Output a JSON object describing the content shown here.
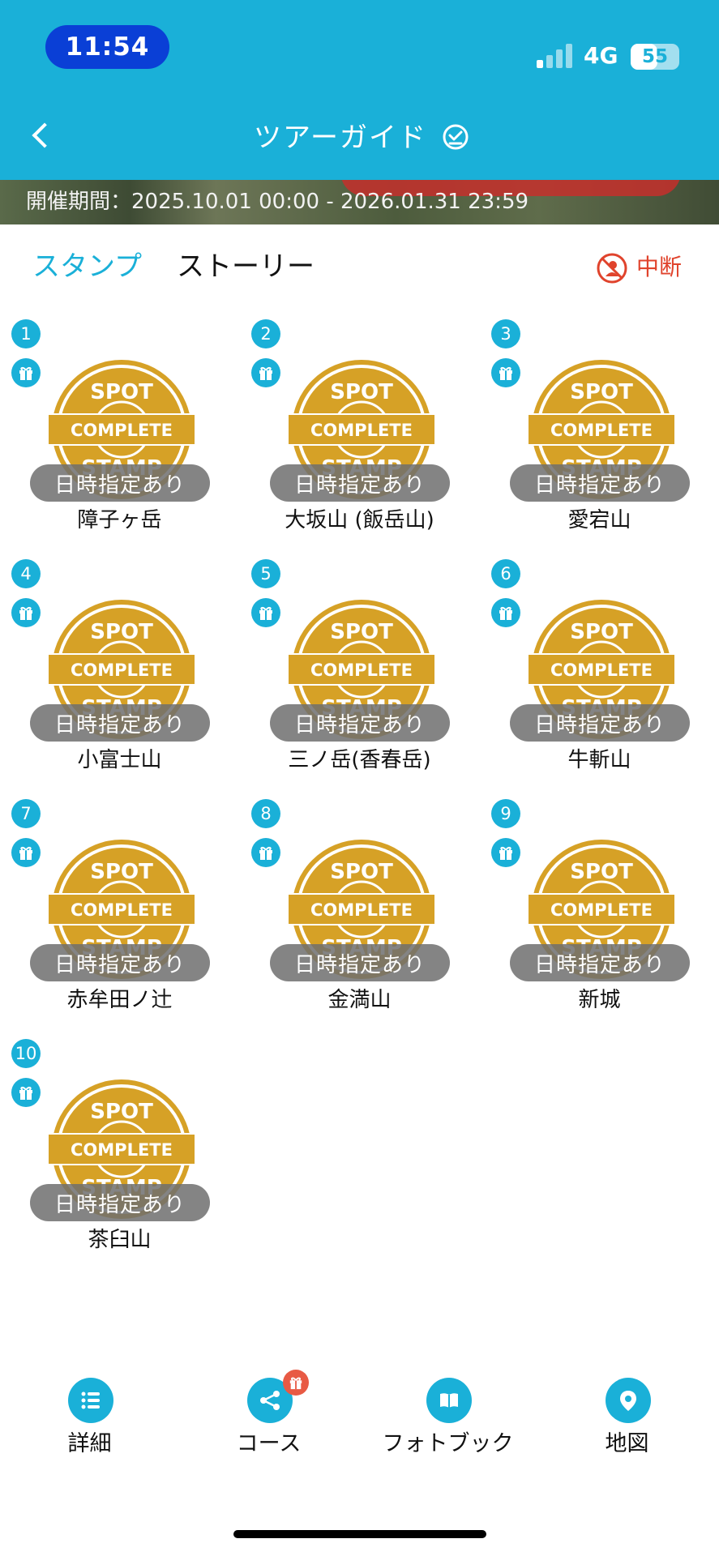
{
  "status_bar": {
    "time": "11:54",
    "network": "4G",
    "battery": "55",
    "battery_level": 0.55
  },
  "header": {
    "title": "ツアーガイド",
    "icons": [
      "back-chevron-icon",
      "check-circle-icon"
    ]
  },
  "banner": {
    "period": "開催期間：2025.10.01 00:00 - 2026.01.31 23:59"
  },
  "tabs": [
    {
      "label": "スタンプ",
      "active": true
    },
    {
      "label": "ストーリー",
      "active": false
    }
  ],
  "suspend": {
    "label": "中断",
    "icon": "suspend-icon",
    "color": "#e0432c"
  },
  "stamp": {
    "top": "SPOT",
    "center": "COMPLETE",
    "bottom": "STAMP",
    "color": "#d6a126"
  },
  "spots": [
    {
      "number": "1",
      "badge": "日時指定あり",
      "name": "障子ヶ岳"
    },
    {
      "number": "2",
      "badge": "日時指定あり",
      "name": "大坂山 (飯岳山)"
    },
    {
      "number": "3",
      "badge": "日時指定あり",
      "name": "愛宕山"
    },
    {
      "number": "4",
      "badge": "日時指定あり",
      "name": "小富士山"
    },
    {
      "number": "5",
      "badge": "日時指定あり",
      "name": "三ノ岳(香春岳)"
    },
    {
      "number": "6",
      "badge": "日時指定あり",
      "name": "牛斬山"
    },
    {
      "number": "7",
      "badge": "日時指定あり",
      "name": "赤牟田ノ辻"
    },
    {
      "number": "8",
      "badge": "日時指定あり",
      "name": "金満山"
    },
    {
      "number": "9",
      "badge": "日時指定あり",
      "name": "新城"
    },
    {
      "number": "10",
      "badge": "日時指定あり",
      "name": "茶臼山"
    }
  ],
  "bottom_nav": [
    {
      "label": "詳細",
      "icon": "list-icon"
    },
    {
      "label": "コース",
      "icon": "share-icon"
    },
    {
      "label": "フォトブック",
      "icon": "book-icon"
    },
    {
      "label": "地図",
      "icon": "map-pin-icon"
    }
  ],
  "accent_color": "#1ab0d8"
}
